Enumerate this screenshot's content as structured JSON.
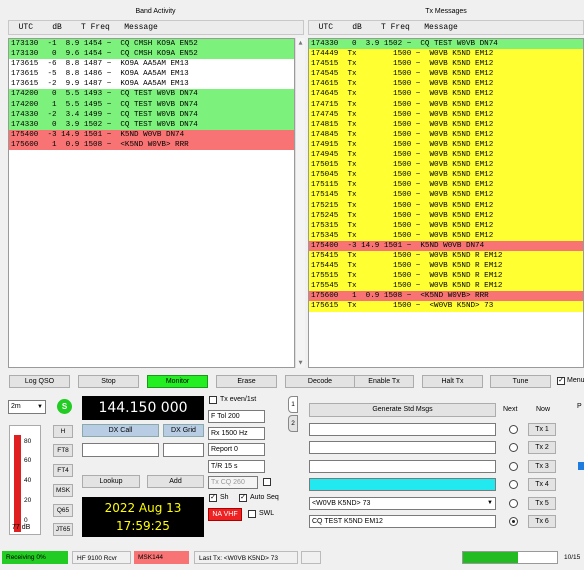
{
  "band_activity": {
    "title": "Band Activity",
    "columns": "  UTC    dB    T Freq   Message",
    "rows": [
      {
        "text": "173130  -1  8.9 1454 ~  CQ CMSH KO9A EN52",
        "color": "g"
      },
      {
        "text": "173130   0  9.6 1454 ~  CQ CMSH KO9A EN52",
        "color": "g"
      },
      {
        "text": "173615  -6  8.8 1487 ~  KO9A AA5AM EM13",
        "color": "w"
      },
      {
        "text": "173615  -5  8.8 1486 ~  KO9A AA5AM EM13",
        "color": "w"
      },
      {
        "text": "173615  -2  9.9 1487 ~  KO9A AA5AM EM13",
        "color": "w"
      },
      {
        "text": "174200   0  5.5 1493 ~  CQ TEST W0VB DN74",
        "color": "g"
      },
      {
        "text": "174200   1  5.5 1495 ~  CQ TEST W0VB DN74",
        "color": "g"
      },
      {
        "text": "174330  -2  3.4 1499 ~  CQ TEST W0VB DN74",
        "color": "g"
      },
      {
        "text": "174330   0  3.9 1502 ~  CQ TEST W0VB DN74",
        "color": "g"
      },
      {
        "text": "175400  -3 14.9 1501 ~  K5ND W0VB DN74",
        "color": "r"
      },
      {
        "text": "175600   1  0.9 1508 ~  <K5ND W0VB> RRR",
        "color": "r"
      }
    ]
  },
  "tx_messages": {
    "title": "Tx Messages",
    "columns": "  UTC    dB    T Freq   Message",
    "rows": [
      {
        "text": "174330   0  3.9 1502 ~  CQ TEST W0VB DN74",
        "color": "g"
      },
      {
        "text": "174449  Tx        1500 ~  W0VB K5ND EM12",
        "color": "y"
      },
      {
        "text": "174515  Tx        1500 ~  W0VB K5ND EM12",
        "color": "y"
      },
      {
        "text": "174545  Tx        1500 ~  W0VB K5ND EM12",
        "color": "y"
      },
      {
        "text": "174615  Tx        1500 ~  W0VB K5ND EM12",
        "color": "y"
      },
      {
        "text": "174645  Tx        1500 ~  W0VB K5ND EM12",
        "color": "y"
      },
      {
        "text": "174715  Tx        1500 ~  W0VB K5ND EM12",
        "color": "y"
      },
      {
        "text": "174745  Tx        1500 ~  W0VB K5ND EM12",
        "color": "y"
      },
      {
        "text": "174815  Tx        1500 ~  W0VB K5ND EM12",
        "color": "y"
      },
      {
        "text": "174845  Tx        1500 ~  W0VB K5ND EM12",
        "color": "y"
      },
      {
        "text": "174915  Tx        1500 ~  W0VB K5ND EM12",
        "color": "y"
      },
      {
        "text": "174945  Tx        1500 ~  W0VB K5ND EM12",
        "color": "y"
      },
      {
        "text": "175015  Tx        1500 ~  W0VB K5ND EM12",
        "color": "y"
      },
      {
        "text": "175045  Tx        1500 ~  W0VB K5ND EM12",
        "color": "y"
      },
      {
        "text": "175115  Tx        1500 ~  W0VB K5ND EM12",
        "color": "y"
      },
      {
        "text": "175145  Tx        1500 ~  W0VB K5ND EM12",
        "color": "y"
      },
      {
        "text": "175215  Tx        1500 ~  W0VB K5ND EM12",
        "color": "y"
      },
      {
        "text": "175245  Tx        1500 ~  W0VB K5ND EM12",
        "color": "y"
      },
      {
        "text": "175315  Tx        1500 ~  W0VB K5ND EM12",
        "color": "y"
      },
      {
        "text": "175345  Tx        1500 ~  W0VB K5ND EM12",
        "color": "y"
      },
      {
        "text": "175400  -3 14.9 1501 ~  K5ND W0VB DN74",
        "color": "r"
      },
      {
        "text": "175415  Tx        1500 ~  W0VB K5ND R EM12",
        "color": "y"
      },
      {
        "text": "175445  Tx        1500 ~  W0VB K5ND R EM12",
        "color": "y"
      },
      {
        "text": "175515  Tx        1500 ~  W0VB K5ND R EM12",
        "color": "y"
      },
      {
        "text": "175545  Tx        1500 ~  W0VB K5ND R EM12",
        "color": "y"
      },
      {
        "text": "175600   1  0.9 1508 ~  <K5ND W0VB> RRR",
        "color": "r"
      },
      {
        "text": "175615  Tx        1500 ~  <W0VB K5ND> 73",
        "color": "y"
      }
    ]
  },
  "buttons": {
    "log_qso": "Log QSO",
    "stop": "Stop",
    "monitor": "Monitor",
    "erase": "Erase",
    "decode": "Decode",
    "enable_tx": "Enable Tx",
    "halt_tx": "Halt Tx",
    "tune": "Tune",
    "menus": "Menus",
    "dx_call": "DX Call",
    "dx_grid": "DX Grid",
    "lookup": "Lookup",
    "add": "Add",
    "generate_std_msgs": "Generate Std Msgs",
    "h": "H",
    "ft8": "FT8",
    "ft4": "FT4",
    "msk": "MSK",
    "q65": "Q65",
    "jt65": "JT65"
  },
  "band": {
    "selected": "2m",
    "frequency": "144.150 000",
    "indicator": "S"
  },
  "level": {
    "ticks": [
      "80",
      "60",
      "40",
      "20",
      "0"
    ],
    "reading": "77 dB",
    "fraction": 0.93
  },
  "controls": {
    "tx_even_label": "Tx even/1st",
    "f_tol": "F Tol  200",
    "rx_freq": "Rx  1500 Hz",
    "report": "Report 0",
    "tr_period": "T/R  15 s",
    "tx_cq": "Tx CQ 260",
    "sh": "Sh",
    "auto_seq": "Auto Seq",
    "na_vhf": "NA VHF",
    "swl": "SWL"
  },
  "clock": {
    "date": "2022 Aug 13",
    "time": "17:59:25"
  },
  "tabs": {
    "tab1": "1",
    "tab2": "2"
  },
  "tx_panel": {
    "next_header": "Next",
    "now_header": "Now",
    "rows": [
      {
        "message": "",
        "button": "Tx 1",
        "active": false
      },
      {
        "message": "",
        "button": "Tx 2",
        "active": false
      },
      {
        "message": "",
        "button": "Tx 3",
        "active": false
      },
      {
        "message": "",
        "button": "Tx 4",
        "active": false
      },
      {
        "message": "<W0VB K5ND> 73",
        "button": "Tx 5",
        "active": false
      },
      {
        "message": "CQ TEST K5ND EM12",
        "button": "Tx 6",
        "active": true
      }
    ],
    "right_letter": "P"
  },
  "status": {
    "receiving": "Receiving   0%",
    "rig": "HF 9100 Rcvr",
    "mode": "MSK144",
    "last_tx": "Last Tx: <W0VB K5ND> 73",
    "progress_fraction": 0.58,
    "right": "10/15"
  },
  "colors": {
    "green": "#7cf27c",
    "red": "#f87474",
    "yellow": "#ffff32",
    "freq_bg": "#000000",
    "freq_fg": "#ffffff",
    "clock_fg": "#ffff00",
    "monitor": "#22ee22",
    "tx5_field": "#22e8f0",
    "na_vhf": "#ee2222",
    "status_green": "#22cc22"
  }
}
